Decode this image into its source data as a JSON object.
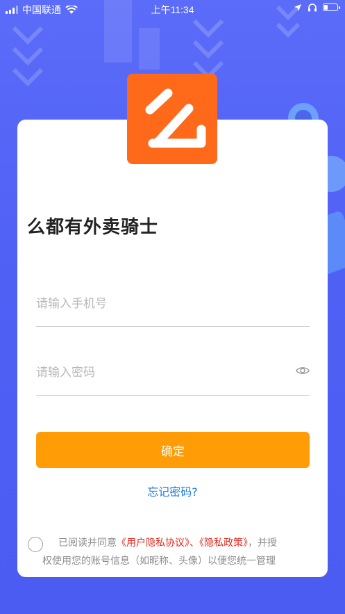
{
  "status_bar": {
    "carrier": "中国联通",
    "time": "上午11:34"
  },
  "login": {
    "app_title": "么都有外卖骑士",
    "phone_placeholder": "请输入手机号",
    "password_placeholder": "请输入密码",
    "confirm_label": "确定",
    "forgot_label": "忘记密码?"
  },
  "agreement": {
    "prefix": "已阅读并同意",
    "user_agreement": "《用户隐私协议》",
    "separator": "、",
    "privacy_policy": "《隐私政策》",
    "suffix_line1": "，并授",
    "line2": "权使用您的账号信息（如昵称、头像）以便您统一管理"
  },
  "colors": {
    "background": "#5b6cf9",
    "logo": "#ff6a1a",
    "button": "#ff9c06",
    "link_blue": "#1f7ae0",
    "link_red": "#e02a1f"
  },
  "icons": [
    "signal-icon",
    "wifi-icon",
    "location-icon",
    "headphones-icon",
    "battery-icon",
    "eye-icon",
    "logo-icon"
  ]
}
